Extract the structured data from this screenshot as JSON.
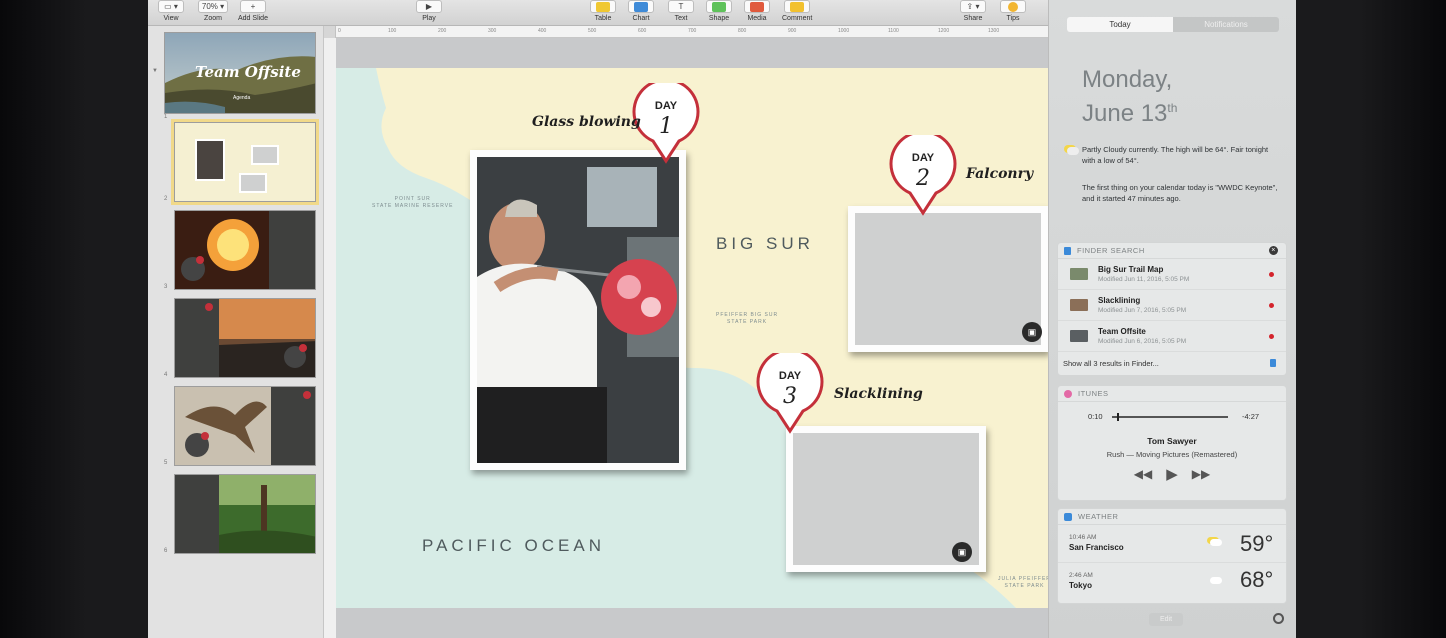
{
  "toolbar": {
    "items": [
      {
        "label": "View",
        "btn": "▭ ▾"
      },
      {
        "label": "Zoom",
        "btn": "70% ▾"
      },
      {
        "label": "Add Slide",
        "btn": "+"
      },
      {
        "label": "Play",
        "btn": "▶"
      },
      {
        "label": "Table",
        "color": "#f0c832"
      },
      {
        "label": "Chart",
        "color": "#3f8bd8"
      },
      {
        "label": "Text",
        "btn": "T"
      },
      {
        "label": "Shape",
        "color": "#5fc25a"
      },
      {
        "label": "Media",
        "color": "#e05a3d"
      },
      {
        "label": "Comment",
        "color": "#f2c12e"
      },
      {
        "label": "Share",
        "btn": "⇪ ▾"
      },
      {
        "label": "Tips",
        "color": "#f2b632"
      }
    ]
  },
  "ruler": {
    "ticks": [
      "0",
      "100",
      "200",
      "300",
      "400",
      "500",
      "600",
      "700",
      "800",
      "900",
      "1000",
      "1100",
      "1200",
      "1300"
    ]
  },
  "navigator": {
    "slides": [
      {
        "num": "1",
        "title": "Team Offsite",
        "subtitle": "Agenda"
      },
      {
        "num": "2"
      },
      {
        "num": "3"
      },
      {
        "num": "4"
      },
      {
        "num": "5"
      },
      {
        "num": "6"
      }
    ]
  },
  "slide": {
    "ocean_label": "PACIFIC OCEAN",
    "region_label": "BIG SUR",
    "park_label_1": "POINT SUR\nSTATE MARINE RESERVE",
    "park_label_2": "PFEIFFER BIG SUR\nSTATE PARK",
    "park_label_3": "JULIA PFEIFFER\nSTATE PARK",
    "days": [
      {
        "day_word": "DAY",
        "day_num": "1",
        "caption": "Glass blowing"
      },
      {
        "day_word": "DAY",
        "day_num": "2",
        "caption": "Falconry"
      },
      {
        "day_word": "DAY",
        "day_num": "3",
        "caption": "Slacklining"
      }
    ]
  },
  "notification_center": {
    "tabs": [
      "Today",
      "Notifications"
    ],
    "date_line1": "Monday,",
    "date_line2": "June 13",
    "date_suffix": "th",
    "weather_summary": "Partly Cloudy currently. The high will be 64°. Fair tonight with a low of 54°.",
    "calendar_summary": "The first thing on your calendar today is \"WWDC Keynote\", and it started 47 minutes ago.",
    "finder_search": {
      "title": "FINDER SEARCH",
      "results": [
        {
          "name": "Big Sur Trail Map",
          "modified": "Modified Jun 11, 2016, 5:05 PM"
        },
        {
          "name": "Slacklining",
          "modified": "Modified Jun 7, 2016, 5:05 PM"
        },
        {
          "name": "Team Offsite",
          "modified": "Modified Jun 6, 2016, 5:05 PM"
        }
      ],
      "show_all": "Show all 3 results in Finder..."
    },
    "itunes": {
      "title": "ITUNES",
      "elapsed": "0:10",
      "remaining": "-4:27",
      "track": "Tom Sawyer",
      "artist_album": "Rush — Moving Pictures (Remastered)",
      "progress": 0.04
    },
    "weather": {
      "title": "WEATHER",
      "cities": [
        {
          "time": "10:46 AM",
          "city": "San Francisco",
          "temp": "59°"
        },
        {
          "time": "2:46 AM",
          "city": "Tokyo",
          "temp": "68°"
        }
      ]
    },
    "edit_label": "Edit"
  }
}
